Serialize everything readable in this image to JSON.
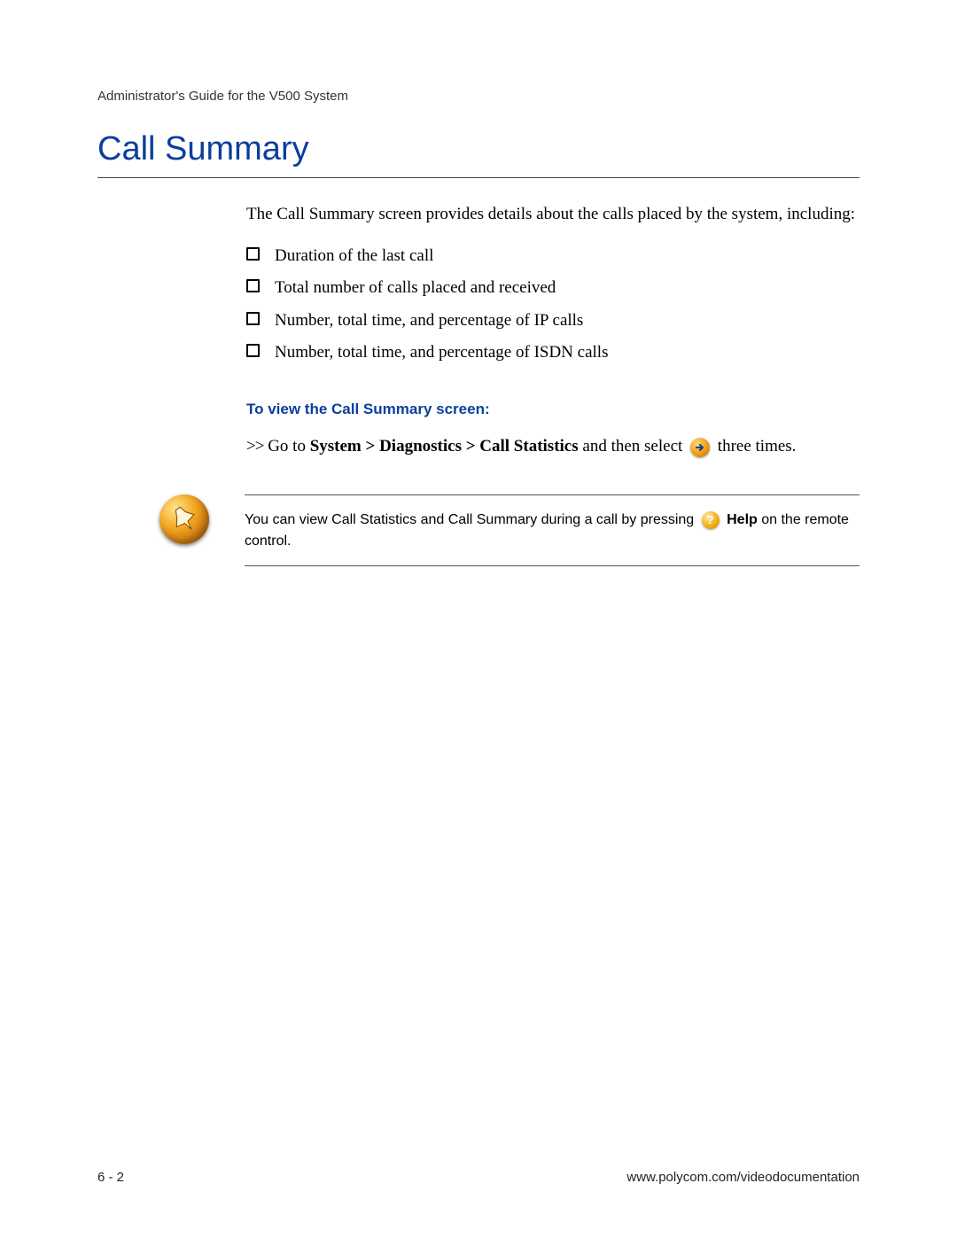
{
  "header": {
    "guide_title": "Administrator's Guide for the V500 System"
  },
  "section": {
    "title": "Call Summary",
    "intro": "The Call Summary screen provides details about the calls placed by the system, including:",
    "bullets": [
      "Duration of the last call",
      "Total number of calls placed and received",
      "Number, total time, and percentage of IP calls",
      "Number, total time, and percentage of ISDN calls"
    ],
    "subheading": "To view the Call Summary screen:",
    "instruction": {
      "prefix_chevrons": ">>",
      "before_bold": "Go to ",
      "bold_path": "System > Diagnostics > Call Statistics",
      "after_bold": " and then select",
      "trailing": "three times."
    }
  },
  "note": {
    "before_icon": "You can view Call Statistics and Call Summary during a call by pressing",
    "help_label": "Help",
    "after_help": " on the remote control."
  },
  "footer": {
    "page_number": "6 - 2",
    "url": "www.polycom.com/videodocumentation"
  }
}
